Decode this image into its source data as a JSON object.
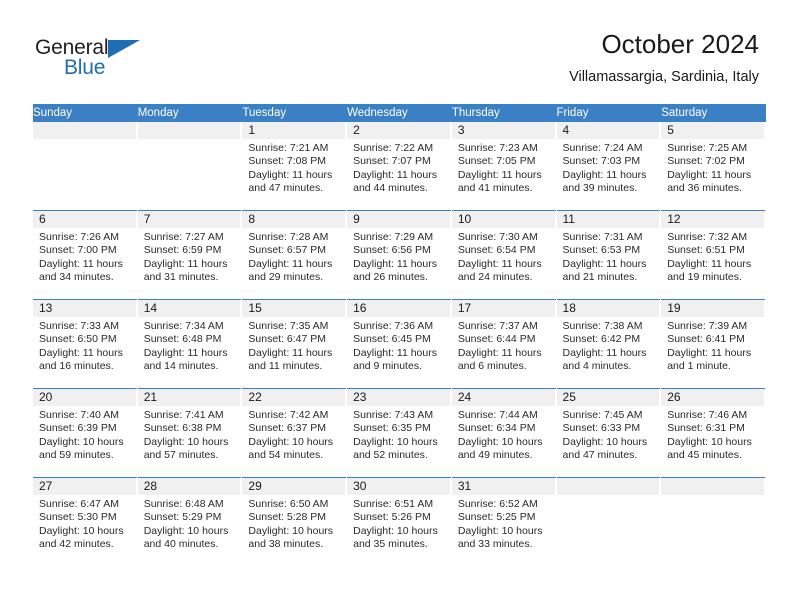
{
  "brand": {
    "name_part1": "General",
    "name_part2": "Blue",
    "triangle_icon": "triangle-icon",
    "color_dark": "#231f20",
    "color_blue": "#1f6db5"
  },
  "header": {
    "title": "October 2024",
    "subtitle": "Villamassargia, Sardinia, Italy"
  },
  "theme": {
    "header_blue": "#3b7fc4",
    "daynum_band": "#f0f0f0",
    "text": "#1a1a1a"
  },
  "weekdays": [
    "Sunday",
    "Monday",
    "Tuesday",
    "Wednesday",
    "Thursday",
    "Friday",
    "Saturday"
  ],
  "weeks": [
    [
      {
        "day": "",
        "sunrise": "",
        "sunset": "",
        "daylight1": "",
        "daylight2": ""
      },
      {
        "day": "",
        "sunrise": "",
        "sunset": "",
        "daylight1": "",
        "daylight2": ""
      },
      {
        "day": "1",
        "sunrise": "Sunrise: 7:21 AM",
        "sunset": "Sunset: 7:08 PM",
        "daylight1": "Daylight: 11 hours",
        "daylight2": "and 47 minutes."
      },
      {
        "day": "2",
        "sunrise": "Sunrise: 7:22 AM",
        "sunset": "Sunset: 7:07 PM",
        "daylight1": "Daylight: 11 hours",
        "daylight2": "and 44 minutes."
      },
      {
        "day": "3",
        "sunrise": "Sunrise: 7:23 AM",
        "sunset": "Sunset: 7:05 PM",
        "daylight1": "Daylight: 11 hours",
        "daylight2": "and 41 minutes."
      },
      {
        "day": "4",
        "sunrise": "Sunrise: 7:24 AM",
        "sunset": "Sunset: 7:03 PM",
        "daylight1": "Daylight: 11 hours",
        "daylight2": "and 39 minutes."
      },
      {
        "day": "5",
        "sunrise": "Sunrise: 7:25 AM",
        "sunset": "Sunset: 7:02 PM",
        "daylight1": "Daylight: 11 hours",
        "daylight2": "and 36 minutes."
      }
    ],
    [
      {
        "day": "6",
        "sunrise": "Sunrise: 7:26 AM",
        "sunset": "Sunset: 7:00 PM",
        "daylight1": "Daylight: 11 hours",
        "daylight2": "and 34 minutes."
      },
      {
        "day": "7",
        "sunrise": "Sunrise: 7:27 AM",
        "sunset": "Sunset: 6:59 PM",
        "daylight1": "Daylight: 11 hours",
        "daylight2": "and 31 minutes."
      },
      {
        "day": "8",
        "sunrise": "Sunrise: 7:28 AM",
        "sunset": "Sunset: 6:57 PM",
        "daylight1": "Daylight: 11 hours",
        "daylight2": "and 29 minutes."
      },
      {
        "day": "9",
        "sunrise": "Sunrise: 7:29 AM",
        "sunset": "Sunset: 6:56 PM",
        "daylight1": "Daylight: 11 hours",
        "daylight2": "and 26 minutes."
      },
      {
        "day": "10",
        "sunrise": "Sunrise: 7:30 AM",
        "sunset": "Sunset: 6:54 PM",
        "daylight1": "Daylight: 11 hours",
        "daylight2": "and 24 minutes."
      },
      {
        "day": "11",
        "sunrise": "Sunrise: 7:31 AM",
        "sunset": "Sunset: 6:53 PM",
        "daylight1": "Daylight: 11 hours",
        "daylight2": "and 21 minutes."
      },
      {
        "day": "12",
        "sunrise": "Sunrise: 7:32 AM",
        "sunset": "Sunset: 6:51 PM",
        "daylight1": "Daylight: 11 hours",
        "daylight2": "and 19 minutes."
      }
    ],
    [
      {
        "day": "13",
        "sunrise": "Sunrise: 7:33 AM",
        "sunset": "Sunset: 6:50 PM",
        "daylight1": "Daylight: 11 hours",
        "daylight2": "and 16 minutes."
      },
      {
        "day": "14",
        "sunrise": "Sunrise: 7:34 AM",
        "sunset": "Sunset: 6:48 PM",
        "daylight1": "Daylight: 11 hours",
        "daylight2": "and 14 minutes."
      },
      {
        "day": "15",
        "sunrise": "Sunrise: 7:35 AM",
        "sunset": "Sunset: 6:47 PM",
        "daylight1": "Daylight: 11 hours",
        "daylight2": "and 11 minutes."
      },
      {
        "day": "16",
        "sunrise": "Sunrise: 7:36 AM",
        "sunset": "Sunset: 6:45 PM",
        "daylight1": "Daylight: 11 hours",
        "daylight2": "and 9 minutes."
      },
      {
        "day": "17",
        "sunrise": "Sunrise: 7:37 AM",
        "sunset": "Sunset: 6:44 PM",
        "daylight1": "Daylight: 11 hours",
        "daylight2": "and 6 minutes."
      },
      {
        "day": "18",
        "sunrise": "Sunrise: 7:38 AM",
        "sunset": "Sunset: 6:42 PM",
        "daylight1": "Daylight: 11 hours",
        "daylight2": "and 4 minutes."
      },
      {
        "day": "19",
        "sunrise": "Sunrise: 7:39 AM",
        "sunset": "Sunset: 6:41 PM",
        "daylight1": "Daylight: 11 hours",
        "daylight2": "and 1 minute."
      }
    ],
    [
      {
        "day": "20",
        "sunrise": "Sunrise: 7:40 AM",
        "sunset": "Sunset: 6:39 PM",
        "daylight1": "Daylight: 10 hours",
        "daylight2": "and 59 minutes."
      },
      {
        "day": "21",
        "sunrise": "Sunrise: 7:41 AM",
        "sunset": "Sunset: 6:38 PM",
        "daylight1": "Daylight: 10 hours",
        "daylight2": "and 57 minutes."
      },
      {
        "day": "22",
        "sunrise": "Sunrise: 7:42 AM",
        "sunset": "Sunset: 6:37 PM",
        "daylight1": "Daylight: 10 hours",
        "daylight2": "and 54 minutes."
      },
      {
        "day": "23",
        "sunrise": "Sunrise: 7:43 AM",
        "sunset": "Sunset: 6:35 PM",
        "daylight1": "Daylight: 10 hours",
        "daylight2": "and 52 minutes."
      },
      {
        "day": "24",
        "sunrise": "Sunrise: 7:44 AM",
        "sunset": "Sunset: 6:34 PM",
        "daylight1": "Daylight: 10 hours",
        "daylight2": "and 49 minutes."
      },
      {
        "day": "25",
        "sunrise": "Sunrise: 7:45 AM",
        "sunset": "Sunset: 6:33 PM",
        "daylight1": "Daylight: 10 hours",
        "daylight2": "and 47 minutes."
      },
      {
        "day": "26",
        "sunrise": "Sunrise: 7:46 AM",
        "sunset": "Sunset: 6:31 PM",
        "daylight1": "Daylight: 10 hours",
        "daylight2": "and 45 minutes."
      }
    ],
    [
      {
        "day": "27",
        "sunrise": "Sunrise: 6:47 AM",
        "sunset": "Sunset: 5:30 PM",
        "daylight1": "Daylight: 10 hours",
        "daylight2": "and 42 minutes."
      },
      {
        "day": "28",
        "sunrise": "Sunrise: 6:48 AM",
        "sunset": "Sunset: 5:29 PM",
        "daylight1": "Daylight: 10 hours",
        "daylight2": "and 40 minutes."
      },
      {
        "day": "29",
        "sunrise": "Sunrise: 6:50 AM",
        "sunset": "Sunset: 5:28 PM",
        "daylight1": "Daylight: 10 hours",
        "daylight2": "and 38 minutes."
      },
      {
        "day": "30",
        "sunrise": "Sunrise: 6:51 AM",
        "sunset": "Sunset: 5:26 PM",
        "daylight1": "Daylight: 10 hours",
        "daylight2": "and 35 minutes."
      },
      {
        "day": "31",
        "sunrise": "Sunrise: 6:52 AM",
        "sunset": "Sunset: 5:25 PM",
        "daylight1": "Daylight: 10 hours",
        "daylight2": "and 33 minutes."
      },
      {
        "day": "",
        "sunrise": "",
        "sunset": "",
        "daylight1": "",
        "daylight2": ""
      },
      {
        "day": "",
        "sunrise": "",
        "sunset": "",
        "daylight1": "",
        "daylight2": ""
      }
    ]
  ]
}
